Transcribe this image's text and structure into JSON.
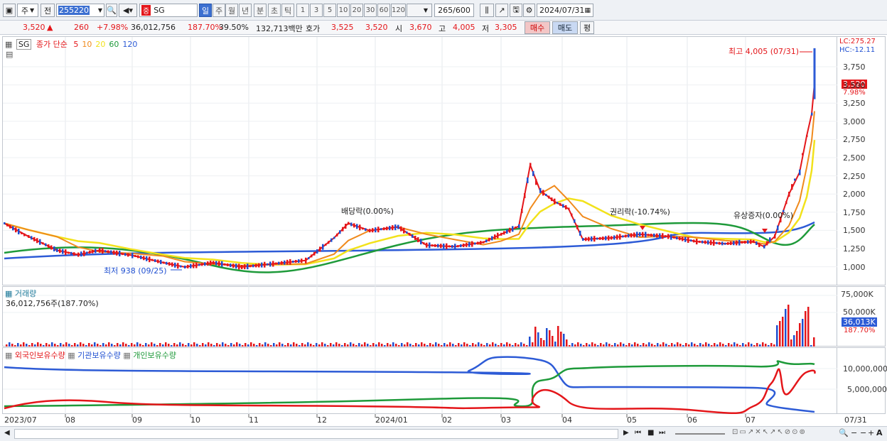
{
  "toolbar": {
    "period_unit": "주",
    "prev_label": "전",
    "code": "255220",
    "stock_name": "SG",
    "badge": "중",
    "intervals": [
      "일",
      "주",
      "월",
      "년",
      "분",
      "초",
      "틱"
    ],
    "counts": [
      "1",
      "3",
      "5",
      "10",
      "20",
      "30",
      "60",
      "120"
    ],
    "view_count": "265",
    "view_total": "/600",
    "date": "2024/07/31"
  },
  "quote": {
    "price": "3,520",
    "arrow": "▲",
    "change": "260",
    "change_pct": "+7.98%",
    "volume": "36,012,756",
    "volume_ratio": "187.70%",
    "turnover": "39.50%",
    "amount": "132,713백만",
    "bid_ask_label": "호가",
    "ask": "3,525",
    "bid": "3,520",
    "open_label": "시",
    "open": "3,670",
    "high_label": "고",
    "high": "4,005",
    "low_label": "저",
    "low": "3,305",
    "buy_label": "매수",
    "sell_label": "매도",
    "eval_label": "평"
  },
  "price_panel": {
    "symbol": "SG",
    "ma_title": "종가 단순",
    "ma_periods": [
      "5",
      "10",
      "20",
      "60",
      "120"
    ],
    "lc": "LC:275.27",
    "hc": "HC:-12.11",
    "high_note": "최고 4,005 (07/31)",
    "low_note": "최저 938 (09/25)",
    "event1": "배당락(0.00%)",
    "event2": "권리락(-10.74%)",
    "event3": "유상증자(0.00%)",
    "price_tag": "3,520",
    "pct_tag": "7.98%",
    "ticks": [
      "3,750",
      "3,500",
      "3,250",
      "3,000",
      "2,750",
      "2,500",
      "2,250",
      "2,000",
      "1,750",
      "1,500",
      "1,250",
      "1,000"
    ]
  },
  "volume_panel": {
    "title": "거래량",
    "value": "36,012,756주(187.70%)",
    "ticks": [
      "75,000K",
      "50,000K"
    ],
    "tag": "36,013K",
    "pct": "187.70%"
  },
  "holding_panel": {
    "legend": [
      "외국인보유수량",
      "기관보유수량",
      "개인보유수량"
    ],
    "ticks": [
      "10,000,000",
      "5,000,000"
    ]
  },
  "x_axis": {
    "labels": [
      "2023/07",
      "08",
      "09",
      "10",
      "11",
      "12",
      "2024/01",
      "02",
      "03",
      "04",
      "05",
      "06",
      "07"
    ],
    "right_label": "07/31"
  },
  "colors": {
    "up": "#e4161a",
    "down": "#1f4fd1",
    "ma5": "#e4161a",
    "ma10": "#f08a1c",
    "ma20": "#f2e21b",
    "ma60": "#1e9a3a",
    "ma120": "#2d5bd6"
  }
}
